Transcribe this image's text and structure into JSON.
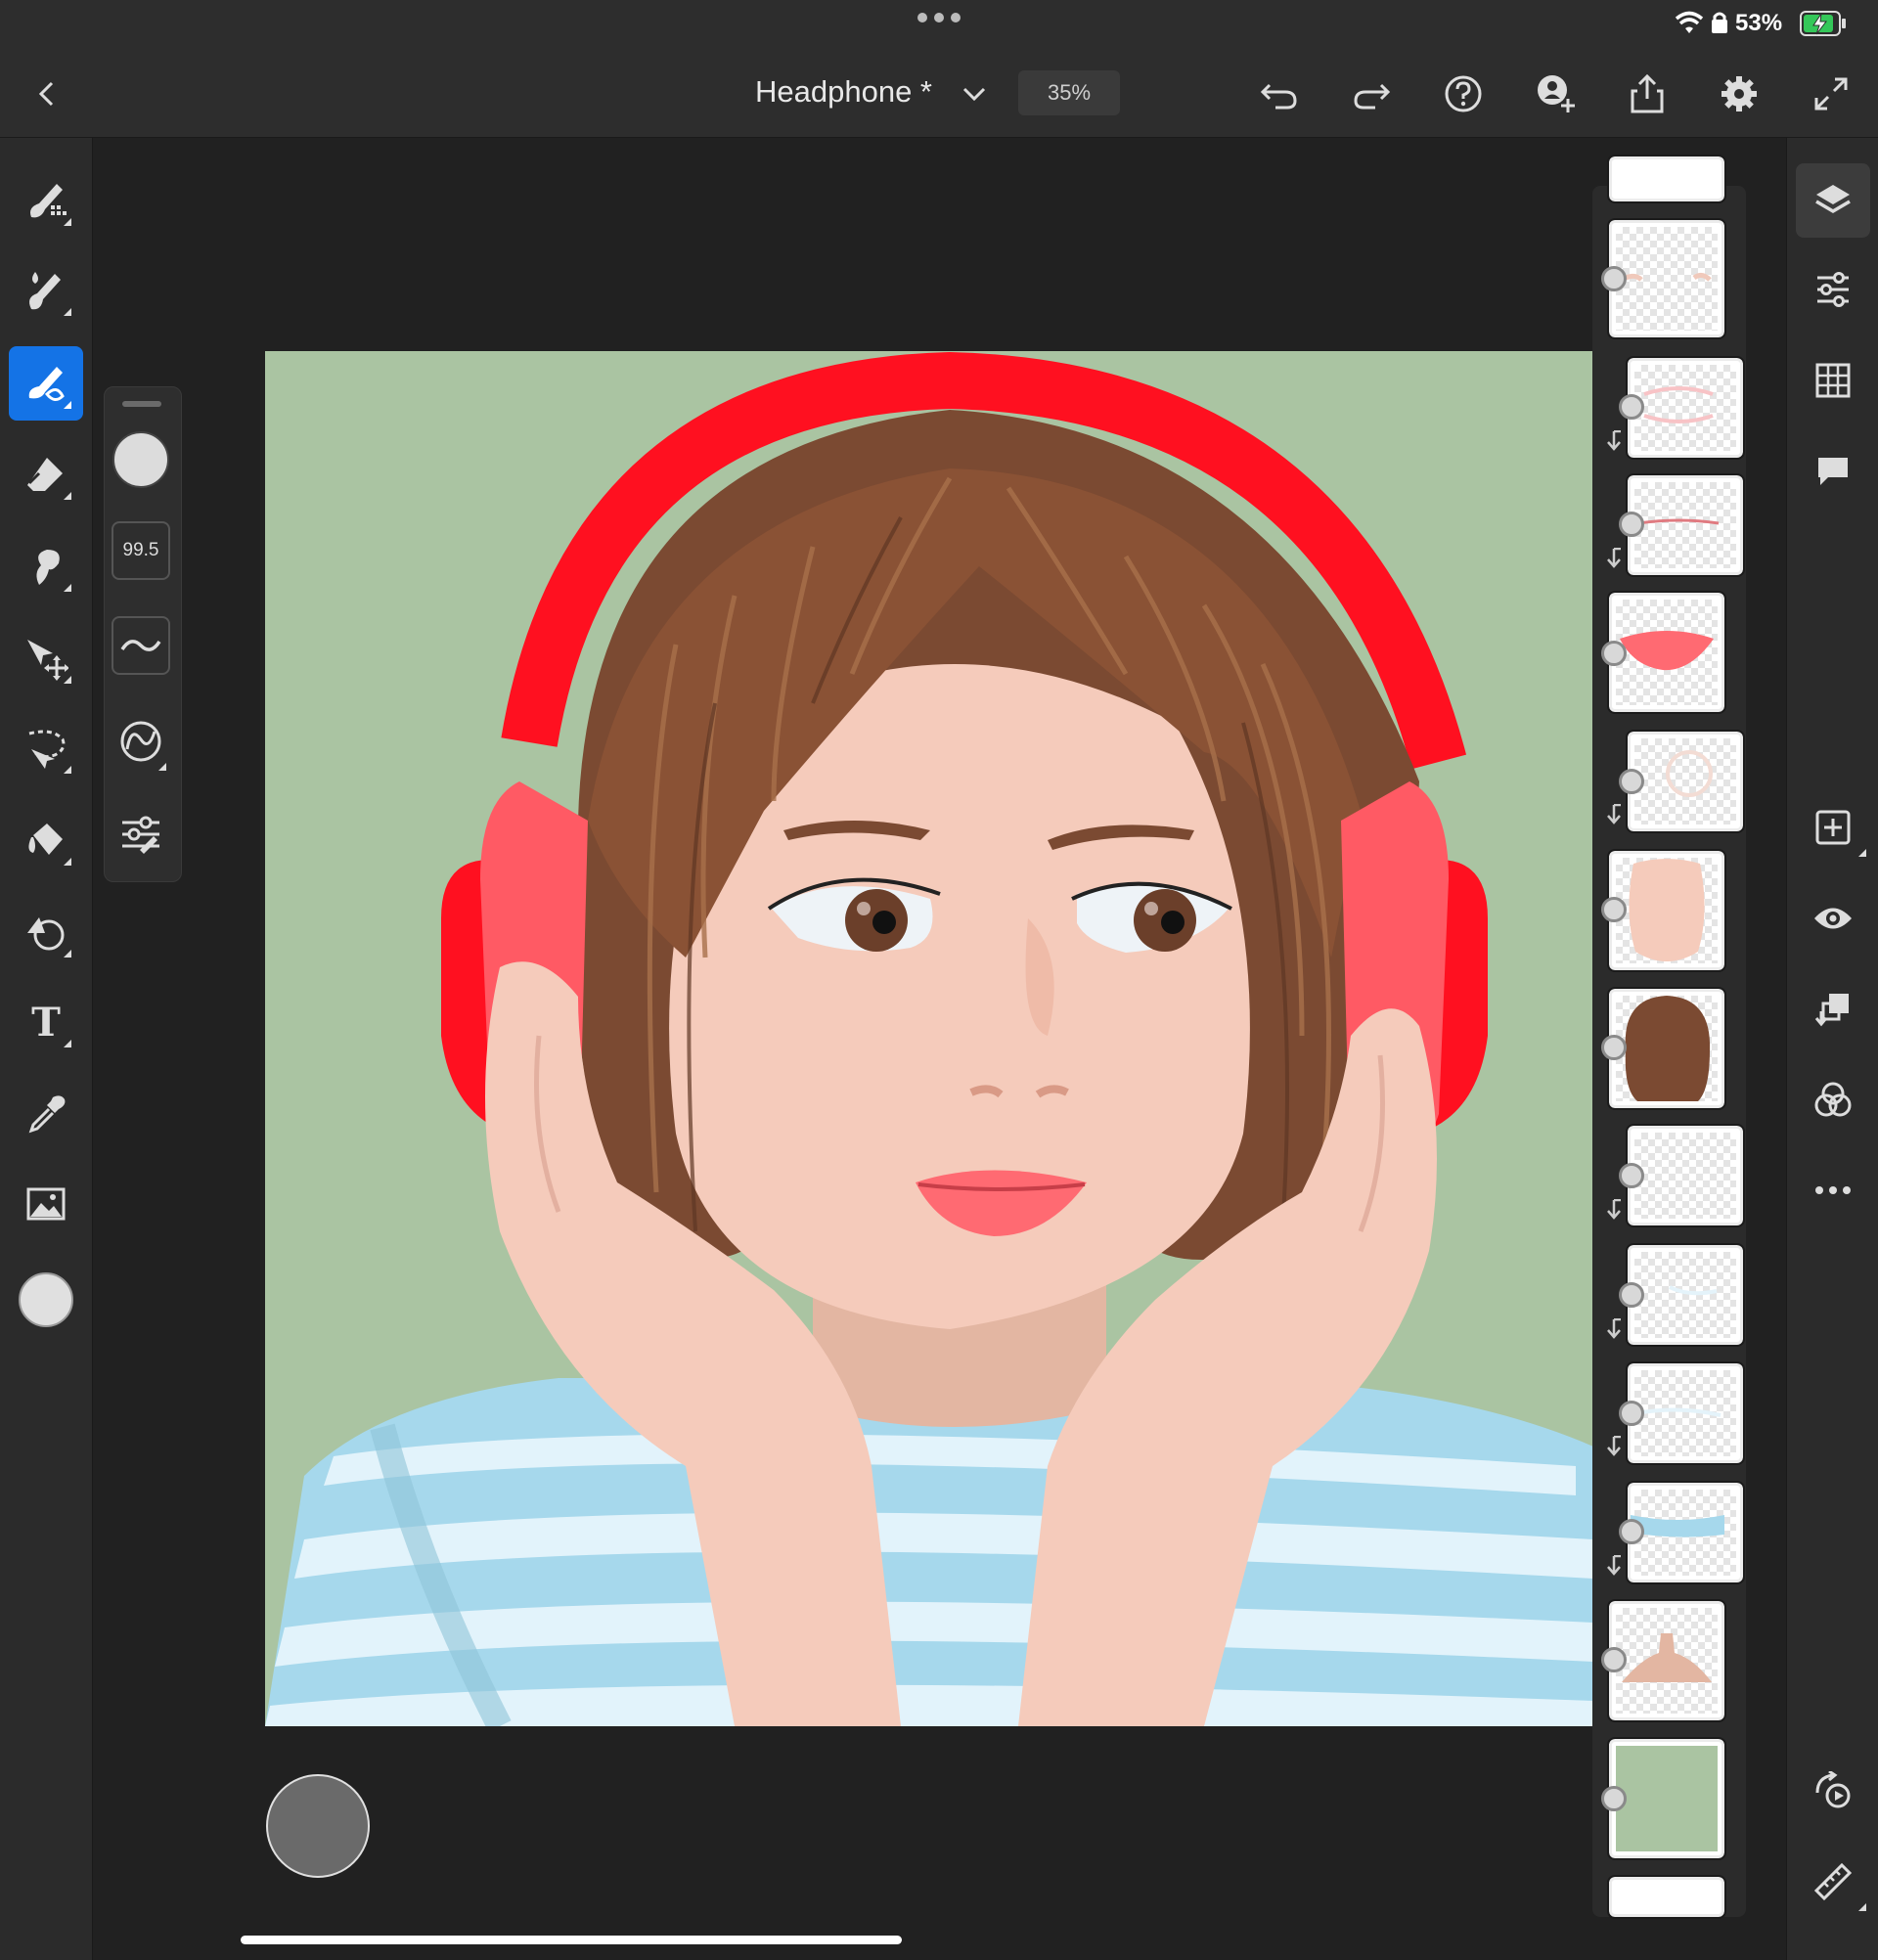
{
  "status_bar": {
    "battery_percent": "53%",
    "icons": [
      "wifi-icon",
      "lock-icon",
      "battery-charging-icon"
    ]
  },
  "header": {
    "document_title": "Headphone *",
    "zoom": "35%",
    "buttons": [
      "back-icon",
      "title-chevron-icon",
      "undo-icon",
      "redo-icon",
      "help-icon",
      "invite-icon",
      "share-icon",
      "settings-icon",
      "fullscreen-icon"
    ]
  },
  "left_toolbar": {
    "tools": [
      "pixel-brush-tool",
      "live-brush-tool",
      "vector-brush-tool",
      "eraser-tool",
      "smudge-tool",
      "transform-tool",
      "selection-tool",
      "fill-tool",
      "shape-tool",
      "text-tool",
      "eyedropper-tool",
      "image-tool",
      "color-swatch"
    ],
    "active_tool": "vector-brush-tool",
    "text_tool_glyph": "T"
  },
  "brush_panel": {
    "size_value": "99.5",
    "controls": [
      "brush-preview",
      "brush-size",
      "smoothing",
      "brush-type",
      "brush-settings"
    ]
  },
  "colors": {
    "accent": "#1473e6",
    "canvas_bg": "#aac4a2",
    "headphone_red": "#ff0a1a",
    "hair_brown": "#7b4a32",
    "skin": "#f5cbbb",
    "shirt_blue": "#a6d8ec"
  },
  "layers": [
    {
      "name": "layer-top-partial",
      "clipped": false
    },
    {
      "name": "layer-blush",
      "clipped": false
    },
    {
      "name": "layer-lip-highlight",
      "clipped": true
    },
    {
      "name": "layer-lip-line",
      "clipped": true
    },
    {
      "name": "layer-lips",
      "clipped": false
    },
    {
      "name": "layer-face-shading",
      "clipped": true
    },
    {
      "name": "layer-face",
      "clipped": false
    },
    {
      "name": "layer-hair",
      "clipped": false
    },
    {
      "name": "layer-empty-1",
      "clipped": true
    },
    {
      "name": "layer-shirt-shade-1",
      "clipped": true
    },
    {
      "name": "layer-shirt-shade-2",
      "clipped": true
    },
    {
      "name": "layer-shirt-stripes",
      "clipped": true
    },
    {
      "name": "layer-neck",
      "clipped": false
    },
    {
      "name": "layer-background",
      "clipped": false
    },
    {
      "name": "layer-bottom-partial",
      "clipped": false
    }
  ],
  "right_rail": {
    "buttons": [
      "layers-icon",
      "adjustments-icon",
      "grid-icon",
      "comments-icon",
      "add-layer-icon",
      "visibility-icon",
      "mask-icon",
      "blend-icon",
      "more-icon",
      "replay-icon",
      "ruler-icon"
    ]
  }
}
